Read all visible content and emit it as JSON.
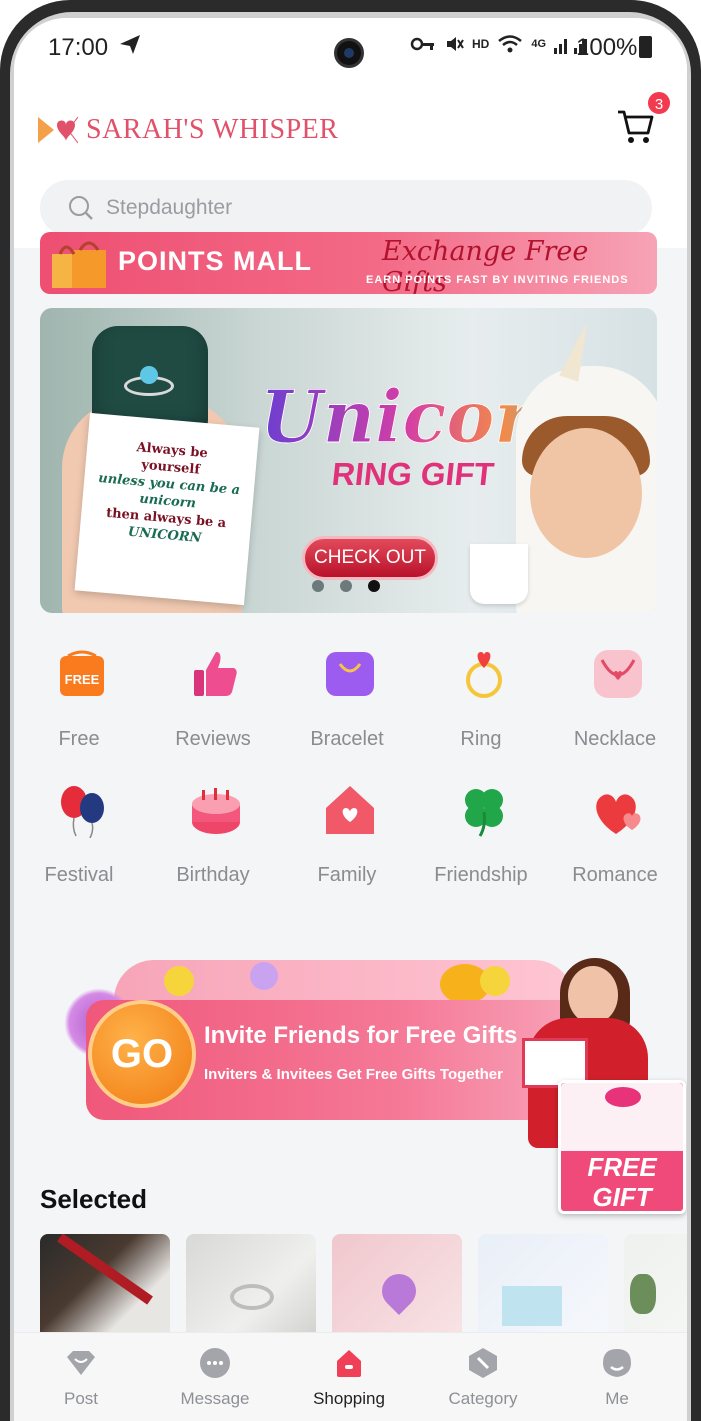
{
  "status_bar": {
    "time": "17:00",
    "network": "HD",
    "signal_label": "4G",
    "battery": "100%"
  },
  "header": {
    "logo_text": "SARAH'S WHISPER",
    "cart_count": "3",
    "search_placeholder": "Stepdaughter"
  },
  "points_banner": {
    "title": "POINTS MALL",
    "script": "Exchange Free Gifts",
    "subtitle": "EARN POINTS FAST BY INVITING FRIENDS"
  },
  "hero": {
    "card_lines": [
      "Always be",
      "yourself",
      "unless you can be a",
      "unicorn",
      "then always be a",
      "UNICORN"
    ],
    "title": "Unicorn",
    "subtitle": "RING GIFT",
    "button": "CHECK OUT",
    "carousel_index": 3,
    "carousel_count": 3
  },
  "categories": [
    {
      "label": "Free",
      "icon": "free-tag-icon"
    },
    {
      "label": "Reviews",
      "icon": "thumbs-up-icon"
    },
    {
      "label": "Bracelet",
      "icon": "bag-icon"
    },
    {
      "label": "Ring",
      "icon": "ring-icon"
    },
    {
      "label": "Necklace",
      "icon": "necklace-icon"
    },
    {
      "label": "Festival",
      "icon": "balloons-icon"
    },
    {
      "label": "Birthday",
      "icon": "cake-icon"
    },
    {
      "label": "Family",
      "icon": "house-heart-icon"
    },
    {
      "label": "Friendship",
      "icon": "clover-icon"
    },
    {
      "label": "Romance",
      "icon": "hearts-icon"
    }
  ],
  "invite": {
    "go": "GO",
    "title": "Invite Friends for Free Gifts",
    "subtitle": "Inviters & Invitees Get Free Gifts Together",
    "badge_line1": "FREE",
    "badge_line2": "GIFT"
  },
  "selected": {
    "title": "Selected"
  },
  "bottom_nav": [
    {
      "label": "Post",
      "icon": "diamond-icon",
      "active": false
    },
    {
      "label": "Message",
      "icon": "chat-bubble-icon",
      "active": false
    },
    {
      "label": "Shopping",
      "icon": "shopping-home-icon",
      "active": true
    },
    {
      "label": "Category",
      "icon": "category-icon",
      "active": false
    },
    {
      "label": "Me",
      "icon": "profile-icon",
      "active": false
    }
  ],
  "colors": {
    "accent": "#e0516a",
    "badge": "#f23b4f",
    "active_nav": "#f04058"
  }
}
